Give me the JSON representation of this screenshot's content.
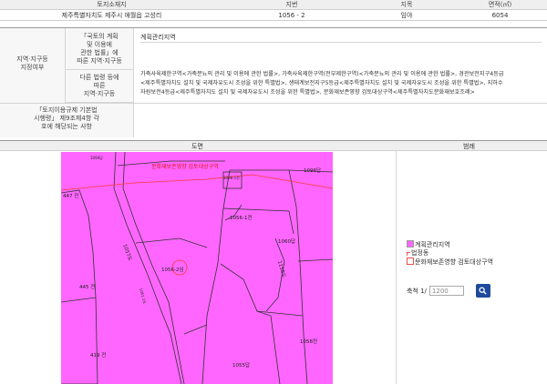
{
  "land_table": {
    "headers": [
      "토지소재지",
      "지번",
      "지목",
      "면적(㎡)"
    ],
    "row": [
      "제주특별자치도 제주시 애월읍 고성리",
      "1056 - 2",
      "임야",
      "6054"
    ]
  },
  "zoning": {
    "side_label": "지역·지구등\n지정여부",
    "national_label": "「국토의 계획\n및 이용에\n관한 법률」에\n따른 지역·지구등",
    "national_value": "계획관리지역",
    "other_label": "다른 법령 등에\n따른\n지역·지구등",
    "other_value": "가축사육제한구역<가축분뇨의 관리 및 이용에 관한 법률>, 가축사육제한구역(전부제한구역)<가축분뇨의 관리 및 이용에 관한 법률>, 경관보전지구4등급\n<제주특별자치도 설치 및 국제자유도시 조성을 위한 특별법>, 생태계보전지구5등급<제주특별자치도 설치 및 국제자유도시 조성을 위한 특별법>, 지하수\n자원보전4등급<제주특별자치도 설치 및 국제자유도시 조성을 위한 특별법>, 문화재보존영향 검토대상구역<제주특별자치도문화재보호조례>",
    "article_label": "「토지이용규제 기본법\n시행령」 제9조제4항 각\n호에 해당되는 사항",
    "article_value": ""
  },
  "map_header": {
    "map_label": "도면",
    "legend_label": "범례"
  },
  "map": {
    "heritage_label": "문화재보존영향 검토대상구역",
    "parcels": [
      "1096답",
      "1096-1전",
      "447 전",
      "1056-1전",
      "1060답",
      "1056-2임",
      "1057도",
      "1158도",
      "445 전",
      "419 전",
      "1058전",
      "1055답",
      "1094답",
      "1061-1도"
    ]
  },
  "legend": {
    "items": [
      {
        "label": "계획관리지역",
        "color": "#ff66ff",
        "style": "fill"
      },
      {
        "label": "법정동",
        "color": "#e94f4f",
        "style": "mark"
      },
      {
        "label": "문화재보존영향 검토대상구역",
        "color": "#e94f4f",
        "style": "outline"
      }
    ]
  },
  "scale": {
    "label": "축척 1/",
    "value": "1200"
  },
  "colors": {
    "zone_fill": "#ff66ff",
    "boundary": "#ff3a3a",
    "button": "#1f4a9c"
  },
  "icons": {
    "search_button": "search-icon"
  }
}
